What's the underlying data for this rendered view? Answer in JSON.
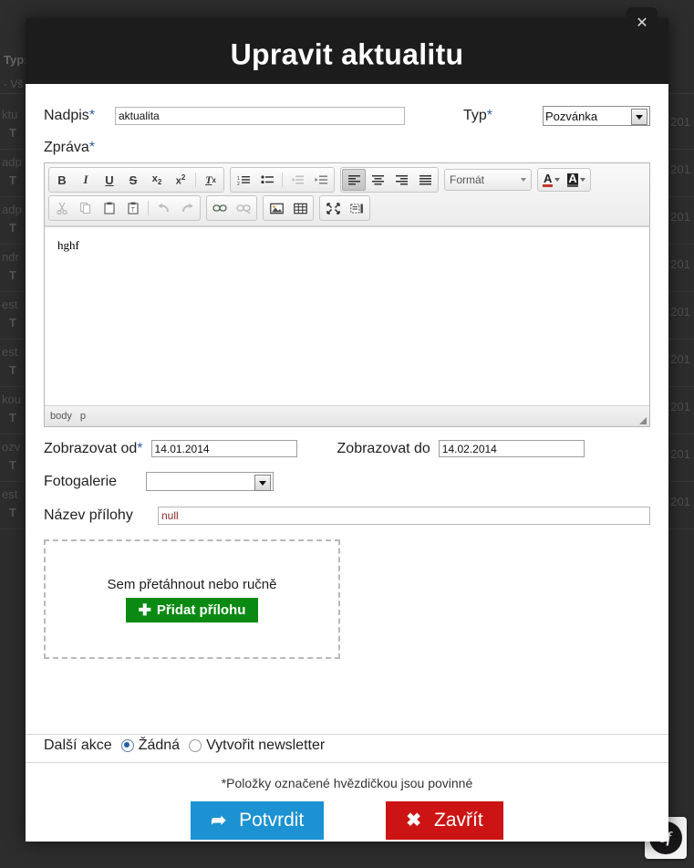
{
  "background": {
    "filter_label": "Typ:",
    "filter_value": "- Vš",
    "rows": [
      {
        "title": "ktu",
        "sub": "T",
        "date": "201"
      },
      {
        "title": "adp",
        "sub": "T",
        "date": "201"
      },
      {
        "title": "adp",
        "sub": "T",
        "date": "201"
      },
      {
        "title": "ndr",
        "sub": "T",
        "date": "201"
      },
      {
        "title": "est",
        "sub": "T",
        "date": "201"
      },
      {
        "title": "est",
        "sub": "T",
        "date": "201"
      },
      {
        "title": "kou",
        "sub": "T",
        "date": "201"
      },
      {
        "title": "ozv",
        "sub": "T",
        "date": "201"
      },
      {
        "title": "est",
        "sub": "T",
        "date": "201"
      }
    ],
    "profiler_badge": "sf"
  },
  "modal": {
    "title": "Upravit aktualitu",
    "close_icon": "✕",
    "fields": {
      "nadpis_label": "Nadpis",
      "nadpis_required": "*",
      "nadpis_value": "aktualita",
      "typ_label": "Typ",
      "typ_required": "*",
      "typ_value": "Pozvánka",
      "zprava_label": "Zpráva",
      "zprava_required": "*",
      "zobrazovat_od_label": "Zobrazovat od",
      "zobrazovat_od_required": "*",
      "zobrazovat_od_value": "14.01.2014",
      "zobrazovat_do_label": "Zobrazovat do",
      "zobrazovat_do_value": "14.02.2014",
      "fotogalerie_label": "Fotogalerie",
      "fotogalerie_value": "",
      "priloha_label": "Název přílohy",
      "priloha_value": "null"
    },
    "editor": {
      "format_label": "Formát",
      "content": "hghf",
      "status_path": [
        "body",
        "p"
      ],
      "toolbar_row1": [
        {
          "name": "bold-button",
          "glyph": "B",
          "state": "normal"
        },
        {
          "name": "italic-button",
          "glyph": "I",
          "state": "normal"
        },
        {
          "name": "underline-button",
          "glyph": "U",
          "state": "normal"
        },
        {
          "name": "strikethrough-button",
          "glyph": "S",
          "state": "normal"
        },
        {
          "name": "subscript-button",
          "glyph": "x₂",
          "state": "normal"
        },
        {
          "name": "superscript-button",
          "glyph": "x²",
          "state": "normal"
        },
        {
          "name": "remove-format-button",
          "glyph": "Tx",
          "state": "normal"
        },
        {
          "name": "numbered-list-button",
          "glyph": "1≡",
          "state": "normal"
        },
        {
          "name": "bulleted-list-button",
          "glyph": "•≡",
          "state": "normal"
        },
        {
          "name": "decrease-indent-button",
          "glyph": "⇤≡",
          "state": "disabled"
        },
        {
          "name": "increase-indent-button",
          "glyph": "⇥≡",
          "state": "disabled"
        },
        {
          "name": "align-left-button",
          "glyph": "≡",
          "state": "active"
        },
        {
          "name": "align-center-button",
          "glyph": "≡",
          "state": "normal"
        },
        {
          "name": "align-right-button",
          "glyph": "≡",
          "state": "normal"
        },
        {
          "name": "align-justify-button",
          "glyph": "≡",
          "state": "normal"
        }
      ],
      "toolbar_row2": [
        {
          "name": "cut-button",
          "glyph": "✂",
          "state": "disabled"
        },
        {
          "name": "copy-button",
          "glyph": "❐",
          "state": "disabled"
        },
        {
          "name": "paste-button",
          "glyph": "📋",
          "state": "normal"
        },
        {
          "name": "paste-text-button",
          "glyph": "📋",
          "state": "normal"
        },
        {
          "name": "undo-button",
          "glyph": "↩",
          "state": "disabled"
        },
        {
          "name": "redo-button",
          "glyph": "↪",
          "state": "disabled"
        },
        {
          "name": "link-button",
          "glyph": "🔗",
          "state": "normal"
        },
        {
          "name": "unlink-button",
          "glyph": "🔗",
          "state": "disabled"
        },
        {
          "name": "image-button",
          "glyph": "🖼",
          "state": "normal"
        },
        {
          "name": "table-button",
          "glyph": "▦",
          "state": "normal"
        },
        {
          "name": "maximize-button",
          "glyph": "⤢",
          "state": "normal"
        },
        {
          "name": "show-blocks-button",
          "glyph": "▤",
          "state": "normal"
        }
      ],
      "text_color_glyph": "A",
      "bg_color_glyph": "A"
    },
    "dropzone": {
      "text": "Sem přetáhnout nebo ručně",
      "button_plus": "✚",
      "button_label": "Přidat přílohu"
    },
    "footer": {
      "further_actions_label": "Další akce",
      "radio_none": "Žádná",
      "radio_newsletter": "Vytvořit newsletter",
      "note": "*Položky označené hvězdičkou jsou povinné",
      "confirm_icon": "➦",
      "confirm_label": "Potvrdit",
      "close_icon": "✖",
      "close_label": "Zavřít"
    }
  },
  "colors": {
    "header_bg": "#1c1c1c",
    "confirm": "#1c92d2",
    "cancel": "#cc1414",
    "add_attachment": "#0a8a12",
    "required_star": "#2f5fa5"
  }
}
